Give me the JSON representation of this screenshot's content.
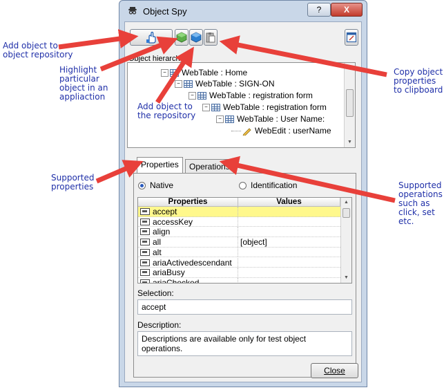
{
  "window": {
    "title": "Object Spy",
    "help_label": "?",
    "close_label": "X"
  },
  "toolbar": {
    "hand_icon": "pointing-hand-icon",
    "add_icon": "cube-add-icon",
    "highlight_icon": "cube-highlight-icon",
    "copy_icon": "clipboard-copy-icon",
    "edit_icon": "edit-window-icon"
  },
  "hierarchy": {
    "label": "Object hierarchy",
    "nodes": [
      {
        "text": "WebTable : Home",
        "expander": "−"
      },
      {
        "text": "WebTable : SIGN-ON",
        "expander": "−"
      },
      {
        "text": "WebTable : registration form",
        "expander": "−"
      },
      {
        "text": "WebTable : registration form",
        "expander": "−"
      },
      {
        "text": "WebTable : User Name:",
        "expander": "−"
      },
      {
        "text": "WebEdit : userName",
        "expander": ""
      }
    ]
  },
  "tabs": [
    {
      "label": "Properties",
      "active": true
    },
    {
      "label": "Operations",
      "active": false
    }
  ],
  "mode": {
    "native_label": "Native",
    "identification_label": "Identification",
    "selected": "native"
  },
  "grid": {
    "headers": [
      "Properties",
      "Values"
    ],
    "rows": [
      {
        "name": "accept",
        "value": "",
        "selected": true
      },
      {
        "name": "accessKey",
        "value": ""
      },
      {
        "name": "align",
        "value": ""
      },
      {
        "name": "all",
        "value": "[object]"
      },
      {
        "name": "alt",
        "value": ""
      },
      {
        "name": "ariaActivedescendant",
        "value": ""
      },
      {
        "name": "ariaBusy",
        "value": ""
      },
      {
        "name": "ariaChecked",
        "value": ""
      }
    ]
  },
  "selection": {
    "label": "Selection:",
    "value": "accept"
  },
  "description": {
    "label": "Description:",
    "value": "Descriptions are available only for test object operations."
  },
  "close_button": "Close",
  "annotations": {
    "add_repo": "Add object to\nobject repository",
    "highlight": "Highlight\nparticular\nobject in an\nappliaction",
    "add_the_repo": "Add object to\nthe repository",
    "copy": "Copy object\nproperties\nto clipboard",
    "supported_props": "Supported\nproperties",
    "supported_ops": "Supported\noperations\nsuch as\nclick, set\netc."
  },
  "colors": {
    "annotation_text": "#1f2fa8",
    "arrow": "#e8403a",
    "selected_row": "#fff88c"
  }
}
